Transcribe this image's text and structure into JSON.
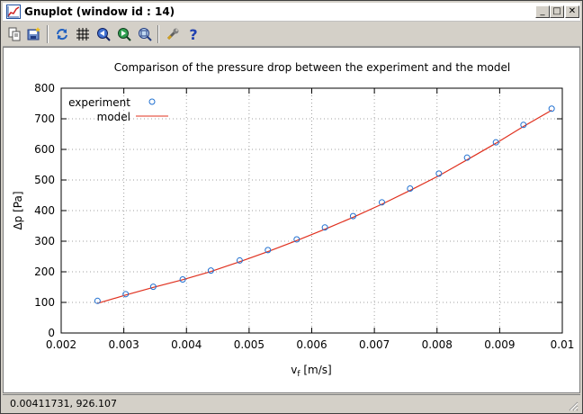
{
  "window": {
    "title": "Gnuplot (window id : 14)",
    "controls": {
      "minimize": "_",
      "maximize": "□",
      "close": "✕"
    }
  },
  "toolbar": {
    "buttons": [
      {
        "name": "copy-clipboard",
        "icon": "copy-icon"
      },
      {
        "name": "print",
        "icon": "print-icon"
      },
      {
        "name": "replot",
        "icon": "refresh-icon"
      },
      {
        "name": "grid",
        "icon": "grid-icon"
      },
      {
        "name": "zoom-previous",
        "icon": "zoom-previous-icon"
      },
      {
        "name": "zoom-next",
        "icon": "zoom-next-icon"
      },
      {
        "name": "autoscale",
        "icon": "zoom-autoscale-icon"
      },
      {
        "name": "options",
        "icon": "wrench-icon"
      },
      {
        "name": "help",
        "icon": "help-icon"
      }
    ]
  },
  "statusbar": {
    "coords": "0.00411731,  926.107"
  },
  "colors": {
    "model_line": "#e0301e",
    "experiment_point": "#1f6fd0",
    "grid": "#a0a0a0"
  },
  "chart_data": {
    "type": "scatter",
    "title": "Comparison of the pressure drop between the experiment and the model",
    "xlabel_main": "v",
    "xlabel_sub": "f",
    "xlabel_unit": " [m/s]",
    "ylabel": "Δp [Pa]",
    "xlim": [
      0.002,
      0.01
    ],
    "ylim": [
      0,
      800
    ],
    "xticks": [
      0.002,
      0.003,
      0.004,
      0.005,
      0.006,
      0.007,
      0.008,
      0.009,
      0.01
    ],
    "xtick_labels": [
      "0.002",
      "0.003",
      "0.004",
      "0.005",
      "0.006",
      "0.007",
      "0.008",
      "0.009",
      "0.01"
    ],
    "yticks": [
      0,
      100,
      200,
      300,
      400,
      500,
      600,
      700,
      800
    ],
    "ytick_labels": [
      "0",
      "100",
      "200",
      "300",
      "400",
      "500",
      "600",
      "700",
      "800"
    ],
    "grid": true,
    "legend_position": "top-left",
    "series": [
      {
        "name": "experiment",
        "style": "points",
        "x": [
          0.00258,
          0.00303,
          0.00347,
          0.00394,
          0.00439,
          0.00485,
          0.0053,
          0.00576,
          0.00621,
          0.00666,
          0.00712,
          0.00757,
          0.00803,
          0.00848,
          0.00894,
          0.00938,
          0.00983
        ],
        "y": [
          105,
          127,
          151,
          175,
          204,
          237,
          271,
          306,
          345,
          382,
          427,
          472,
          521,
          573,
          623,
          680,
          733
        ]
      },
      {
        "name": "model",
        "style": "line",
        "x": [
          0.00258,
          0.00303,
          0.00347,
          0.00394,
          0.00439,
          0.00485,
          0.0053,
          0.00576,
          0.00621,
          0.00666,
          0.00712,
          0.00757,
          0.00803,
          0.00848,
          0.00894,
          0.00938,
          0.00983
        ],
        "y": [
          97,
          124,
          149,
          174,
          201,
          233,
          266,
          302,
          339,
          378,
          421,
          466,
          514,
          566,
          620,
          675,
          728
        ]
      }
    ]
  }
}
